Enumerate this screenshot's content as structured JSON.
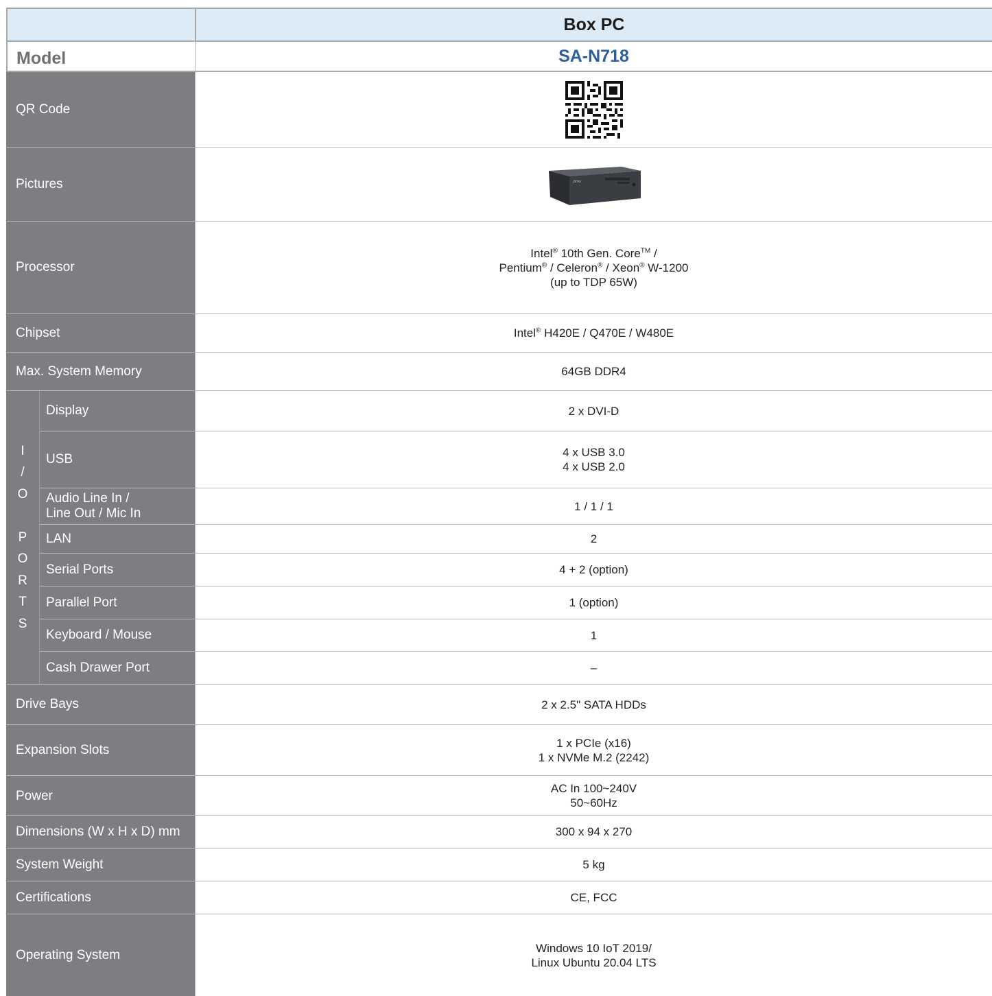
{
  "header": {
    "title": "Box PC"
  },
  "model": {
    "label": "Model",
    "value": "SA-N718"
  },
  "rows": {
    "qr": {
      "label": "QR Code"
    },
    "pictures": {
      "label": "Pictures",
      "product_mark": "prox"
    },
    "processor": {
      "label": "Processor",
      "l1a": "Intel",
      "l1b": "®",
      "l1c": " 10th Gen. Core",
      "l1d": "TM",
      "l1e": " /",
      "l2a": "Pentium",
      "l2b": "®",
      "l2c": " / Celeron",
      "l2d": "®",
      "l2e": " / Xeon",
      "l2f": "®",
      "l2g": " W-1200",
      "l3": "(up to TDP 65W)"
    },
    "chipset": {
      "label": "Chipset",
      "a": "Intel",
      "b": "®",
      "c": " H420E / Q470E / W480E"
    },
    "memory": {
      "label": "Max. System Memory",
      "value": "64GB DDR4"
    },
    "io": {
      "group": [
        "I",
        "/",
        "O",
        "",
        "P",
        "O",
        "R",
        "T",
        "S"
      ],
      "display": {
        "label": "Display",
        "value": "2 x DVI-D"
      },
      "usb": {
        "label": "USB",
        "v1": "4 x USB 3.0",
        "v2": "4 x USB 2.0"
      },
      "audio": {
        "l1": "Audio Line In /",
        "l2": "Line Out / Mic In",
        "value": "1 / 1 / 1"
      },
      "lan": {
        "label": "LAN",
        "value": "2"
      },
      "serial": {
        "label": "Serial Ports",
        "value": "4 + 2 (option)"
      },
      "parallel": {
        "label": "Parallel Port",
        "value": "1 (option)"
      },
      "kbm": {
        "label": "Keyboard / Mouse",
        "value": "1"
      },
      "cash": {
        "label": "Cash Drawer Port",
        "value": "–"
      }
    },
    "drive": {
      "label": "Drive Bays",
      "value": "2 x 2.5\" SATA HDDs"
    },
    "expansion": {
      "label": "Expansion Slots",
      "v1": "1 x PCIe (x16)",
      "v2": "1 x NVMe M.2 (2242)"
    },
    "power": {
      "label": "Power",
      "v1": "AC In 100~240V",
      "v2": "50~60Hz"
    },
    "dimensions": {
      "label": "Dimensions (W x H x D) mm",
      "value": "300 x 94 x 270"
    },
    "weight": {
      "label": "System Weight",
      "value": "5 kg"
    },
    "cert": {
      "label": "Certifications",
      "value": "CE, FCC"
    },
    "os": {
      "label": "Operating System",
      "v1": "Windows 10 IoT 2019/",
      "v2": "Linux Ubuntu 20.04 LTS"
    }
  },
  "colors": {
    "label_bg": "#7d7e82",
    "header_bg": "#dcebf6",
    "model_text": "#2d5f9e"
  }
}
